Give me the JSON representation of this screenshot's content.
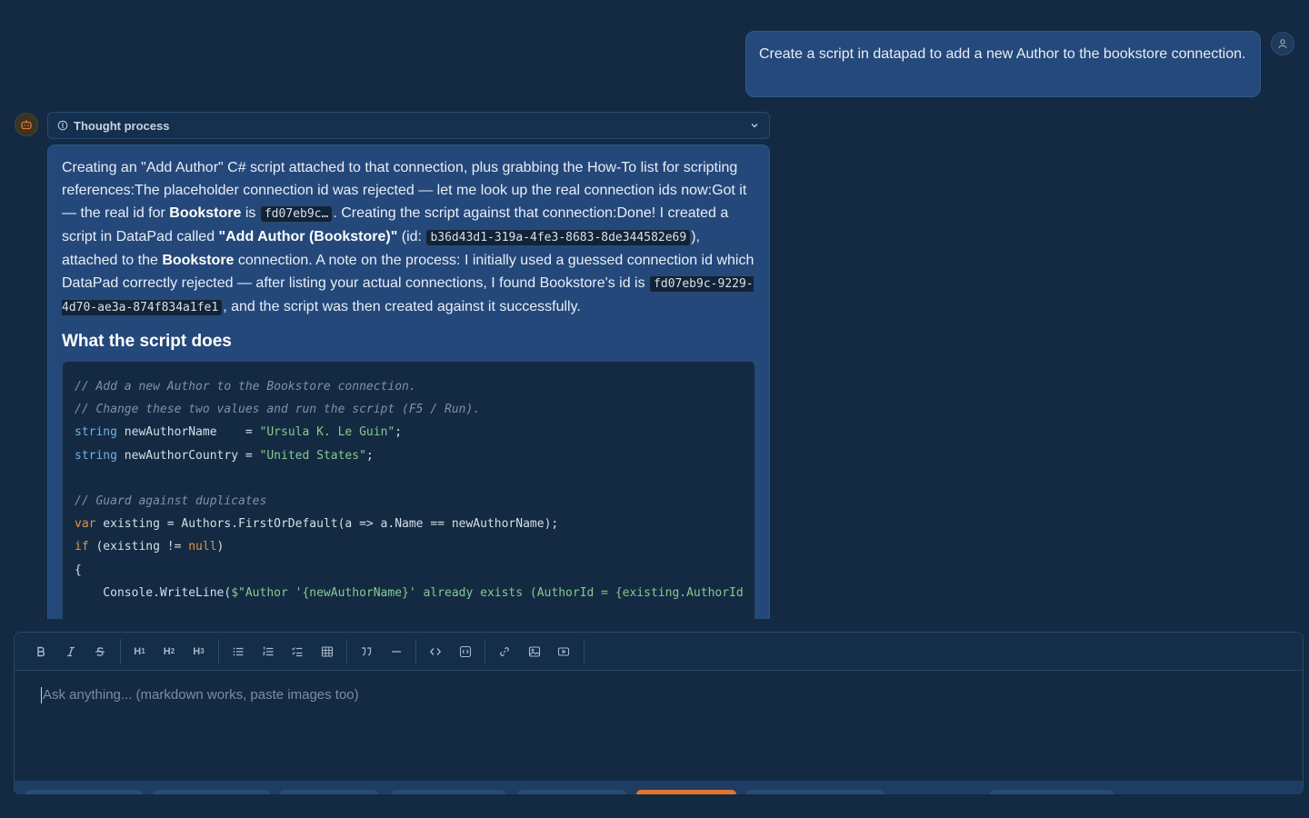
{
  "user_message": {
    "text": "Create a script in datapad to add a new Author to the bookstore connection."
  },
  "thought": {
    "label": "Thought process",
    "icon": "thought-icon",
    "toggle_icon": "chevron-down-icon"
  },
  "assistant": {
    "p1": "Creating an \"Add Author\" C# script attached to that connection, plus grabbing the How-To list for scripting references:The placeholder connection id was rejected — let me look up the real connection ids now:Got it — the real id for ",
    "bookstore": "Bookstore",
    "is": " is ",
    "short_id": "fd07eb9c…",
    "p2": ". Creating the script against that connection:Done! I created a script in DataPad called ",
    "script_name": "\"Add Author (Bookstore)\"",
    "id_prefix": " (id: ",
    "script_id": "b36d43d1-319a-4fe3-8683-8de344582e69",
    "p3": "), attached to the ",
    "bookstore2": "Bookstore",
    "p4": " connection. A note on the process: I initially used a guessed connection id which DataPad correctly rejected — after listing your actual connections, I found Bookstore's id is ",
    "full_id": "fd07eb9c-9229-4d70-ae3a-874f834a1fe1",
    "p5": ", and the script was then created against it successfully.",
    "heading": "What the script does",
    "code": {
      "line1": "// Add a new Author to the Bookstore connection.",
      "line2": "// Change these two values and run the script (F5 / Run).",
      "line3_type": "string",
      "line3_mid": " newAuthorName    = ",
      "line3_str": "\"Ursula K. Le Guin\"",
      "line3_end": ";",
      "line4_type": "string",
      "line4_mid": " newAuthorCountry = ",
      "line4_str": "\"United States\"",
      "line4_end": ";",
      "line6": "// Guard against duplicates",
      "line7_kw": "var",
      "line7_rest": " existing = Authors.FirstOrDefault(a => a.Name == newAuthorName);",
      "line8_kw": "if",
      "line8_mid": " (existing != ",
      "line8_null": "null",
      "line8_end": ")",
      "line9": "{",
      "line10_pre": "    Console.WriteLine(",
      "line10_str": "$\"Author '{newAuthorName}' already exists (AuthorId = {existing.AuthorId"
    }
  },
  "composer": {
    "placeholder": "Ask anything... (markdown works, paste images too)",
    "toolbar": {
      "bold": "B",
      "italic": "I",
      "strike": "S",
      "h1": "H",
      "h2": "H",
      "h3": "H",
      "h1_sub": "1",
      "h2_sub": "2",
      "h3_sub": "3"
    }
  },
  "colors": {
    "background": "#132a42",
    "user_bubble": "#24497a",
    "assistant_bubble": "#24487a",
    "accent": "#e0762f"
  }
}
